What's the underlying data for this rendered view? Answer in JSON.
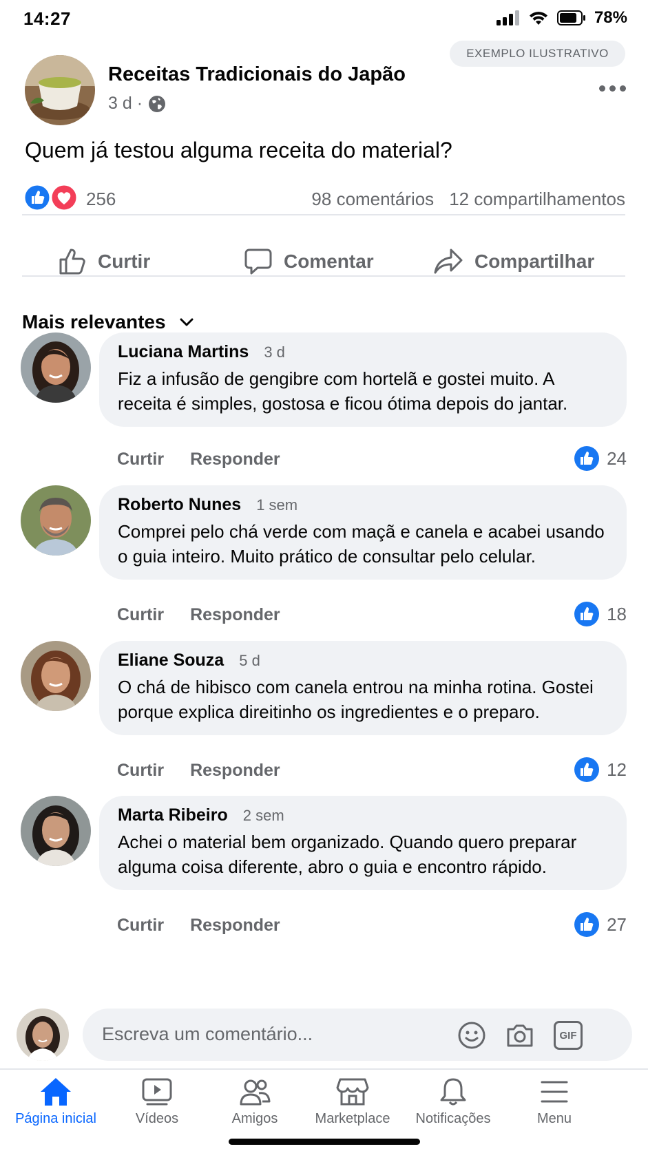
{
  "status_bar": {
    "time": "14:27",
    "battery": "78%"
  },
  "badge": "EXEMPLO ILUSTRATIVO",
  "post": {
    "page_name": "Receitas Tradicionais do Japão",
    "time": "3 d ·",
    "text": "Quem já testou alguma receita do material?",
    "reactions_count": "256",
    "comments_count": "98 comentários",
    "shares_count": "12 compartilhamentos"
  },
  "actions": {
    "like": "Curtir",
    "comment": "Comentar",
    "share": "Compartilhar"
  },
  "sort": {
    "label": "Mais relevantes"
  },
  "comments": [
    {
      "name": "Luciana Martins",
      "time": "3 d",
      "text": "Fiz a infusão de gengibre com hortelã e gostei muito. A receita é simples, gostosa e ficou ótima depois do jantar.",
      "like_label": "Curtir",
      "reply_label": "Responder",
      "likes": "24"
    },
    {
      "name": "Roberto Nunes",
      "time": "1 sem",
      "text": "Comprei pelo chá verde com maçã e canela e acabei usando o guia inteiro. Muito prático de consultar pelo celular.",
      "like_label": "Curtir",
      "reply_label": "Responder",
      "likes": "18"
    },
    {
      "name": "Eliane Souza",
      "time": "5 d",
      "text": "O chá de hibisco com canela entrou na minha rotina. Gostei porque explica direitinho os ingredientes e o preparo.",
      "like_label": "Curtir",
      "reply_label": "Responder",
      "likes": "12"
    },
    {
      "name": "Marta Ribeiro",
      "time": "2 sem",
      "text": "Achei o material bem organizado. Quando quero preparar alguma coisa diferente, abro o guia e encontro rápido.",
      "like_label": "Curtir",
      "reply_label": "Responder",
      "likes": "27"
    }
  ],
  "composer": {
    "placeholder": "Escreva um comentário...",
    "gif_label": "GIF"
  },
  "nav": {
    "home": "Página inicial",
    "videos": "Vídeos",
    "friends": "Amigos",
    "marketplace": "Marketplace",
    "notifications": "Notificações",
    "menu": "Menu"
  },
  "colors": {
    "accent": "#0866ff",
    "like_blue": "#1877f2",
    "love_red": "#f33e58",
    "muted": "#65676b",
    "bubble": "#f0f2f5"
  }
}
